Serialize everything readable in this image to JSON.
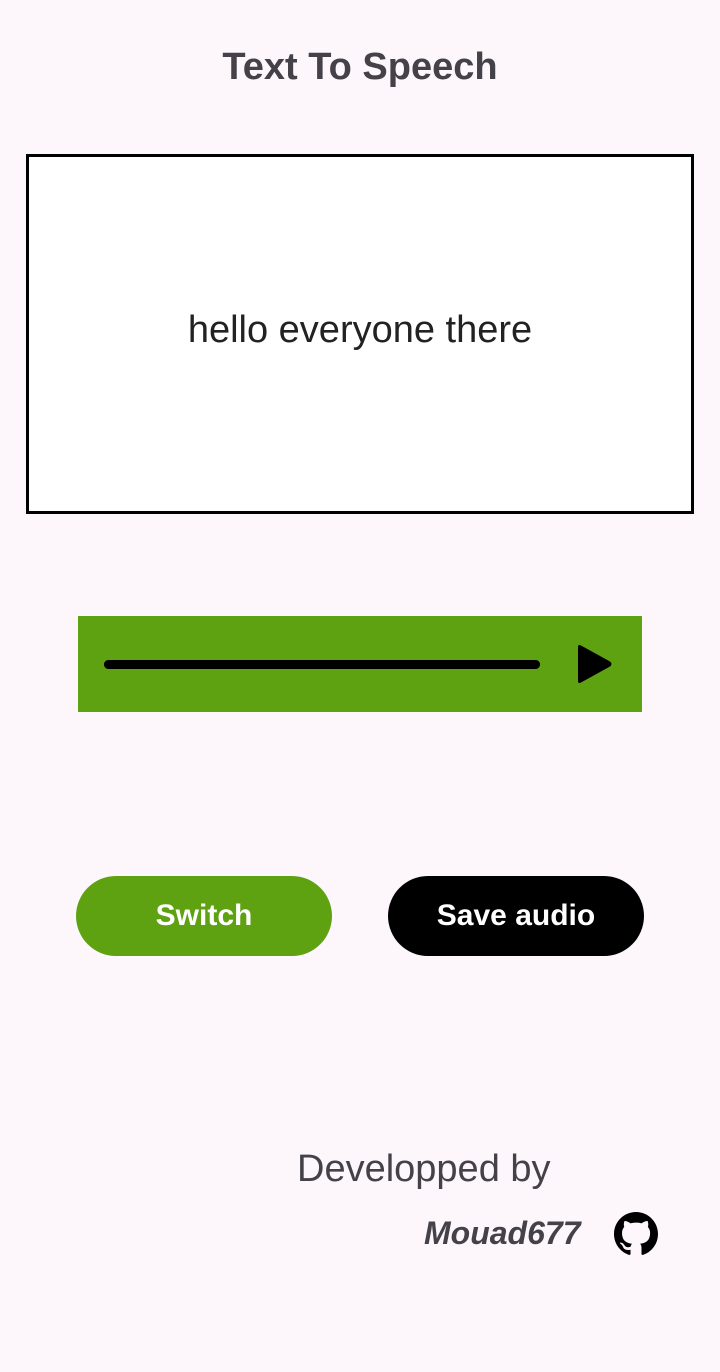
{
  "header": {
    "title": "Text To Speech"
  },
  "text_input": {
    "value": "hello everyone there"
  },
  "player": {
    "progress": 1.0,
    "play_icon": "play-icon",
    "background_color": "#5fa211"
  },
  "actions": {
    "switch_label": "Switch",
    "save_label": "Save audio"
  },
  "footer": {
    "developed_by": "Developped by",
    "author": "Mouad677",
    "author_icon": "github-icon"
  },
  "colors": {
    "accent": "#5fa211",
    "dark": "#000000",
    "text": "#444149",
    "background": "#fdf7fc"
  }
}
